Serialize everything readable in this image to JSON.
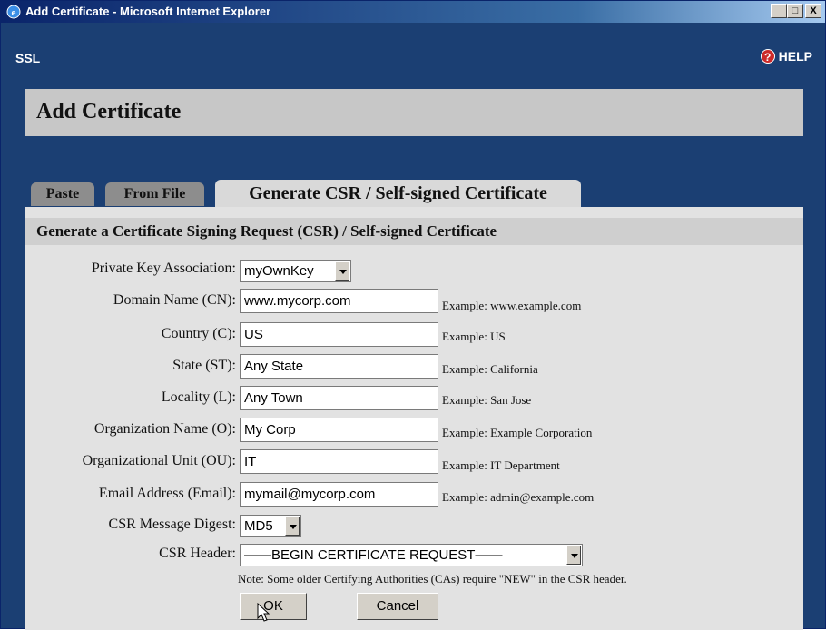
{
  "window": {
    "title": "Add Certificate - Microsoft Internet Explorer",
    "minimize_label": "_",
    "maximize_label": "□",
    "close_label": "X"
  },
  "app": {
    "section_label": "SSL",
    "help_label": "HELP",
    "help_icon": "?"
  },
  "page": {
    "title": "Add Certificate"
  },
  "tabs": [
    {
      "label": "Paste",
      "active": false
    },
    {
      "label": "From File",
      "active": false
    },
    {
      "label": "Generate CSR / Self-signed Certificate",
      "active": true
    }
  ],
  "form": {
    "section_title": "Generate a Certificate Signing Request (CSR) / Self-signed Certificate",
    "private_key": {
      "label": "Private Key Association:",
      "value": "myOwnKey"
    },
    "domain": {
      "label": "Domain Name (CN):",
      "value": "www.mycorp.com",
      "example": "Example: www.example.com"
    },
    "country": {
      "label": "Country (C):",
      "value": "US",
      "example": "Example: US"
    },
    "state": {
      "label": "State (ST):",
      "value": "Any State",
      "example": "Example: California"
    },
    "locality": {
      "label": "Locality (L):",
      "value": "Any Town",
      "example": "Example: San Jose"
    },
    "organization": {
      "label": "Organization Name (O):",
      "value": "My Corp",
      "example": "Example: Example Corporation"
    },
    "org_unit": {
      "label": "Organizational Unit (OU):",
      "value": "IT",
      "example": "Example: IT Department"
    },
    "email": {
      "label": "Email Address (Email):",
      "value": "mymail@mycorp.com",
      "example": "Example: admin@example.com"
    },
    "digest": {
      "label": "CSR Message Digest:",
      "value": "MD5"
    },
    "header": {
      "label": "CSR Header:",
      "value": "——BEGIN CERTIFICATE REQUEST——"
    },
    "note": "Note: Some older Certifying Authorities (CAs) require \"NEW\" in the CSR header.",
    "ok_label": "OK",
    "cancel_label": "Cancel"
  },
  "colors": {
    "title_bar": "#0a246a",
    "background": "#1b3f73",
    "panel": "#e2e2e2",
    "header_box": "#c7c7c7",
    "inactive_tab": "#8d8d8d"
  }
}
